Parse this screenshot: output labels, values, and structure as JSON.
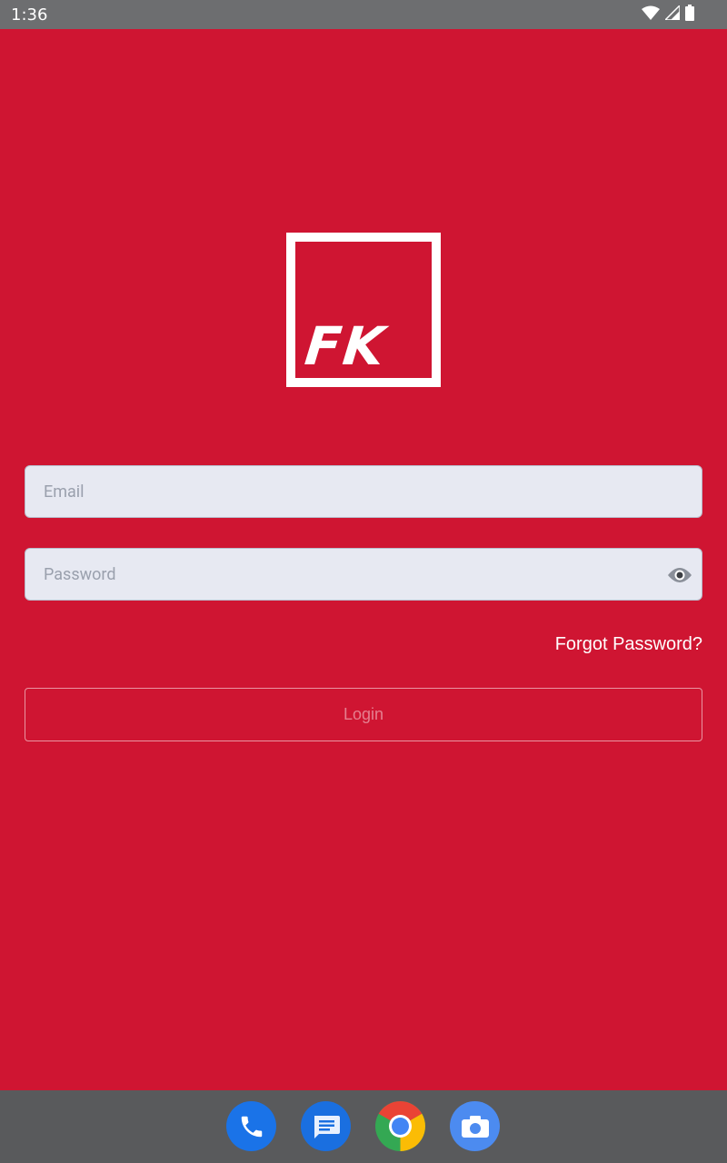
{
  "status_bar": {
    "time": "1:36",
    "icons": [
      "wifi-icon",
      "signal-icon",
      "battery-icon"
    ]
  },
  "logo": {
    "text": "FK"
  },
  "login_form": {
    "email_placeholder": "Email",
    "email_value": "",
    "password_placeholder": "Password",
    "password_value": "",
    "forgot_password_label": "Forgot Password?",
    "login_label": "Login"
  },
  "dock": {
    "apps": [
      "phone-icon",
      "messages-icon",
      "chrome-icon",
      "camera-icon"
    ]
  },
  "colors": {
    "brand_red": "#cf1532",
    "status_bar": "#6d6e70",
    "dock": "#595a5c",
    "field_bg": "#e7e9f2"
  }
}
